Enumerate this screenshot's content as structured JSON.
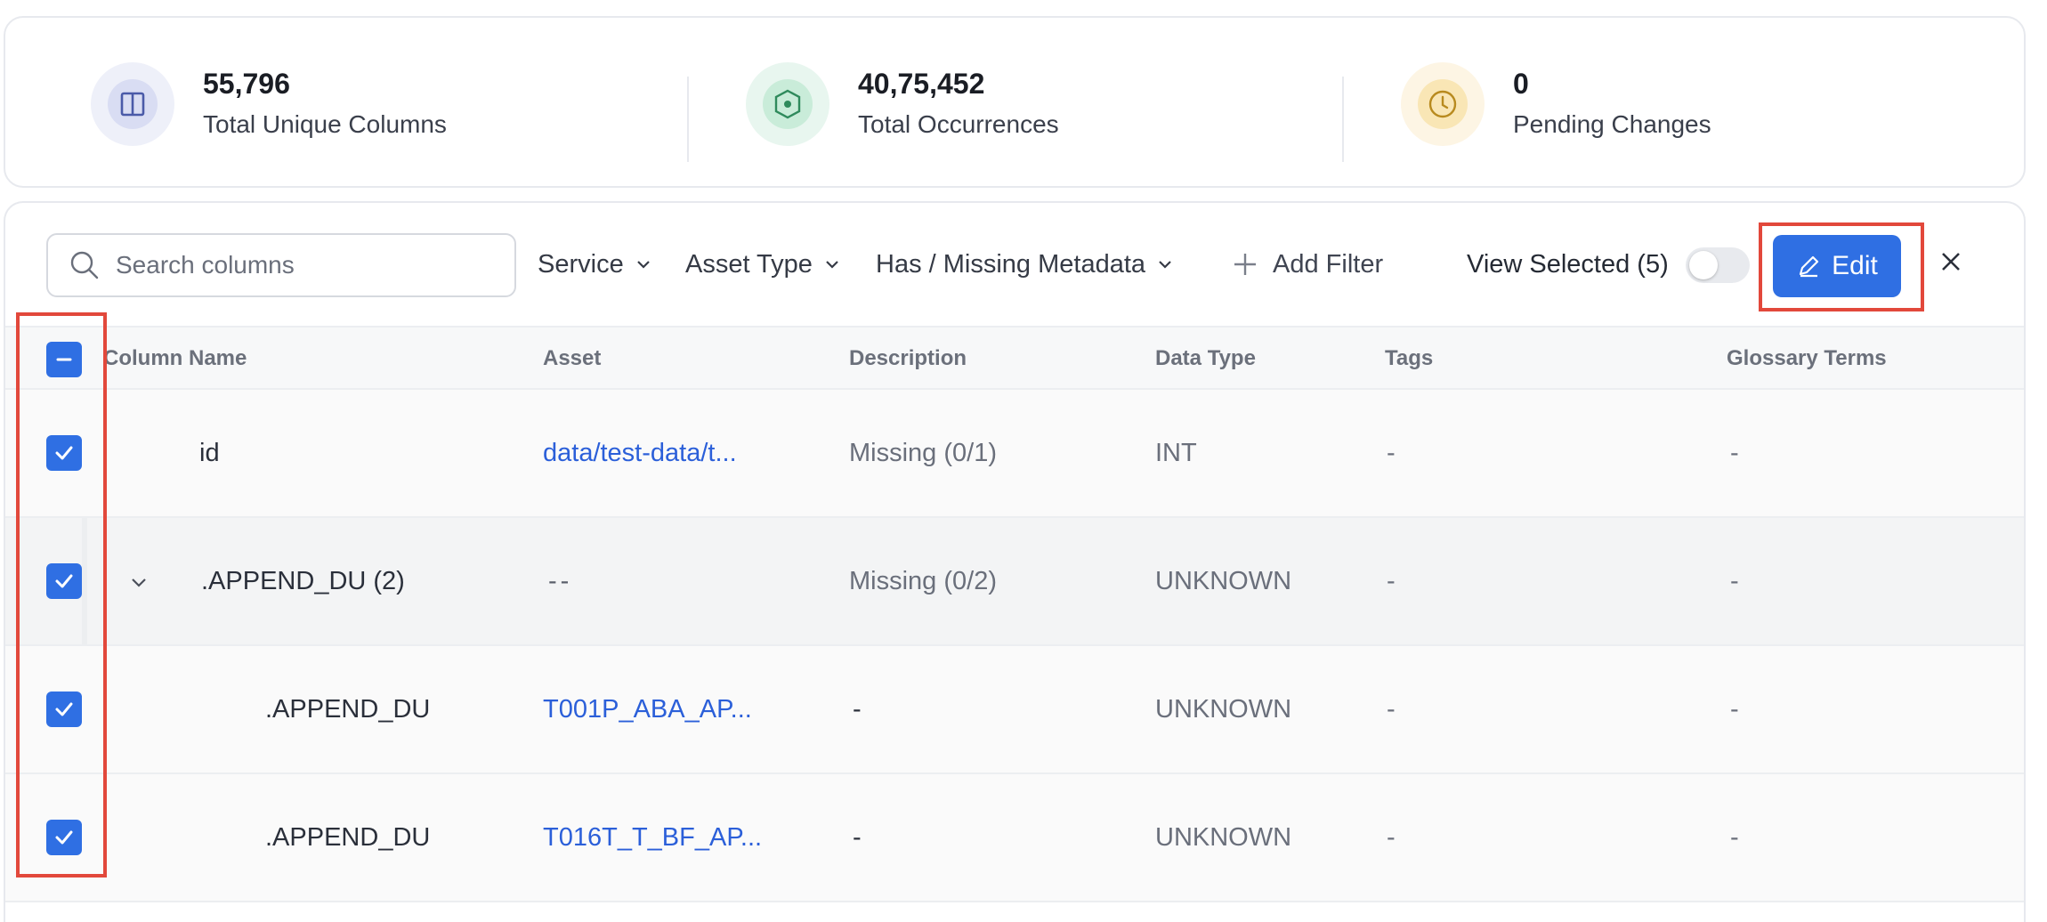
{
  "stats": [
    {
      "value": "55,796",
      "label": "Total Unique Columns",
      "icon": "columns-icon",
      "bg_outer": "#eef0f9",
      "bg_inner": "#d9ddf3",
      "color": "#4a5aa8"
    },
    {
      "value": "40,75,452",
      "label": "Total Occurrences",
      "icon": "occurrence-target-icon",
      "bg_outer": "#e8f6ef",
      "bg_inner": "#c9ecd9",
      "color": "#2f8a5c"
    },
    {
      "value": "0",
      "label": "Pending Changes",
      "icon": "clock-icon",
      "bg_outer": "#fdf5e4",
      "bg_inner": "#f9e6b5",
      "color": "#b88a1e"
    }
  ],
  "toolbar": {
    "search_placeholder": "Search columns",
    "filters": [
      "Service",
      "Asset Type",
      "Has / Missing Metadata"
    ],
    "add_filter": "Add Filter",
    "view_selected": "View Selected (5)",
    "edit": "Edit"
  },
  "table": {
    "headers": [
      "Column Name",
      "Asset",
      "Description",
      "Data Type",
      "Tags",
      "Glossary Terms"
    ],
    "rows": [
      {
        "name": "id",
        "asset": "data/test-data/t...",
        "description": "Missing (0/1)",
        "data_type": "INT",
        "tags": "-",
        "glossary": "-"
      },
      {
        "name": ".APPEND_DU (2)",
        "asset": "--",
        "description": "Missing (0/2)",
        "data_type": "UNKNOWN",
        "tags": "-",
        "glossary": "-"
      },
      {
        "name": ".APPEND_DU",
        "asset": "T001P_ABA_AP...",
        "description": "-",
        "data_type": "UNKNOWN",
        "tags": "-",
        "glossary": "-"
      },
      {
        "name": ".APPEND_DU",
        "asset": "T016T_T_BF_AP...",
        "description": "-",
        "data_type": "UNKNOWN",
        "tags": "-",
        "glossary": "-"
      }
    ]
  },
  "colors": {
    "accent": "#2f6fe3",
    "link": "#2b5fd9",
    "highlight": "#e2483b"
  }
}
